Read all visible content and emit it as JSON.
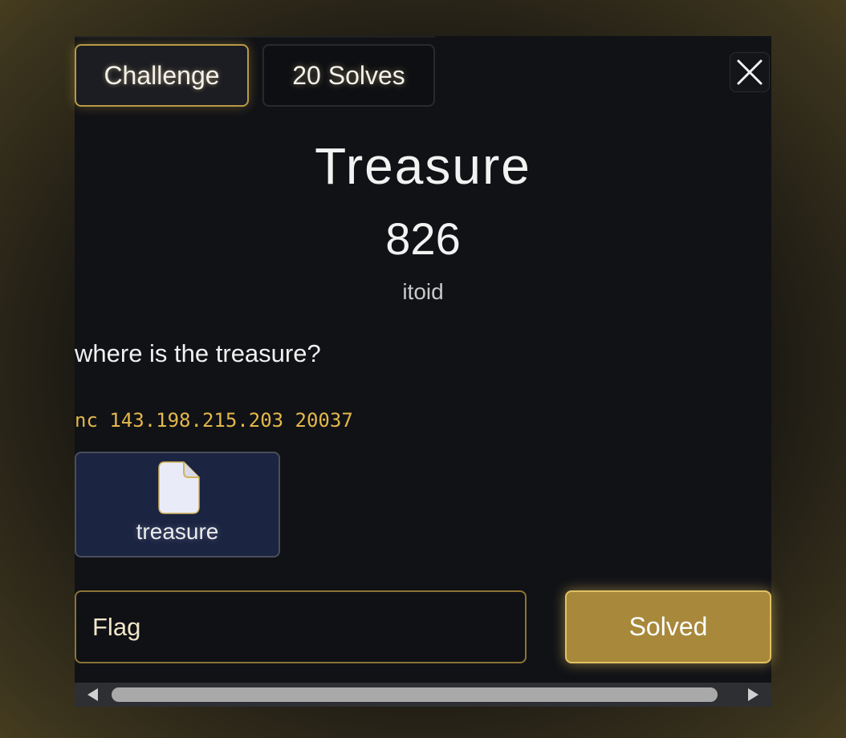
{
  "tabs": {
    "challenge_label": "Challenge",
    "solves_label": "20 Solves"
  },
  "challenge": {
    "name": "Treasure",
    "points": "826",
    "author": "itoid",
    "description": "where is the treasure?",
    "connection": "nc 143.198.215.203 20037"
  },
  "attachment": {
    "filename": "treasure",
    "icon": "file-icon"
  },
  "submission": {
    "placeholder": "Flag",
    "button_label": "Solved"
  },
  "icons": {
    "close": "close-icon",
    "scroll_left": "scroll-left-arrow-icon",
    "scroll_right": "scroll-right-arrow-icon"
  },
  "colors": {
    "accent_gold": "#e2c163",
    "button_gold": "#a8883a",
    "command_text": "#e3b84b",
    "file_card_bg": "#1b2440",
    "modal_bg": "#111216"
  }
}
